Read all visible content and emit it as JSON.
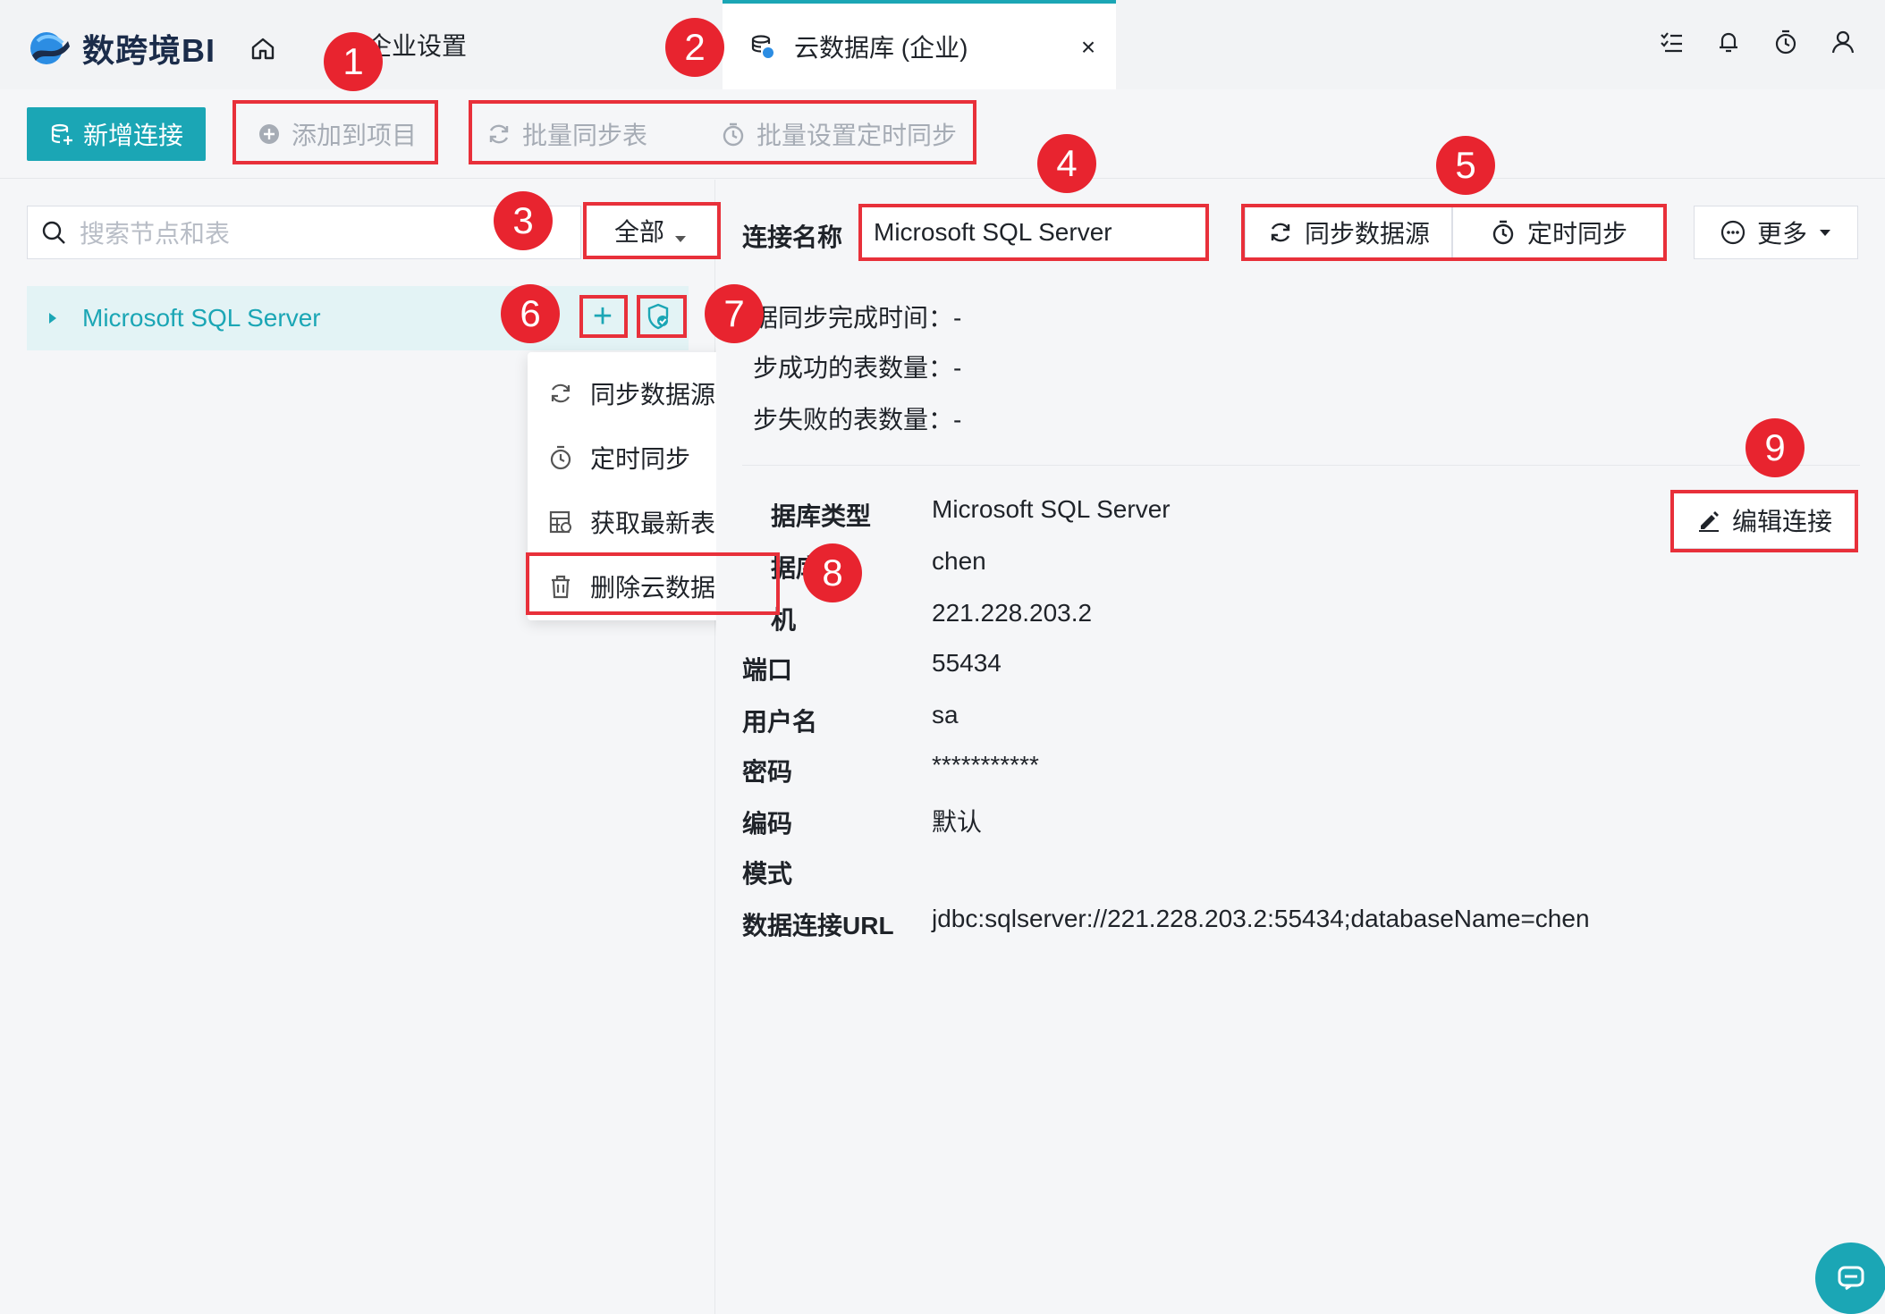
{
  "app": {
    "logo_text": "数跨境BI"
  },
  "tabs": [
    {
      "label": "企业设置"
    },
    {
      "label": "云数据库 (企业)",
      "close": "×"
    }
  ],
  "toolbar": {
    "new_connection": "新增连接",
    "add_to_project": "添加到项目",
    "batch_sync": "批量同步表",
    "batch_schedule": "批量设置定时同步"
  },
  "left": {
    "search_placeholder": "搜索节点和表",
    "filter": "全部",
    "tree_item": "Microsoft SQL Server",
    "tree_add": "+",
    "menu": [
      "同步数据源",
      "定时同步",
      "获取最新表",
      "删除云数据库"
    ]
  },
  "right": {
    "conn_name_label": "连接名称",
    "conn_name_value": "Microsoft SQL Server",
    "sync_button": "同步数据源",
    "schedule_button": "定时同步",
    "more_button": "更多",
    "stats": [
      {
        "label": "数据同步完成时间：",
        "visible": "据同步完成时间：",
        "value": "-"
      },
      {
        "label": "同步成功的表数量：",
        "visible": "步成功的表数量：",
        "value": "-"
      },
      {
        "label": "同步失败的表数量：",
        "visible": "步失败的表数量：",
        "value": "-"
      }
    ],
    "edit_button": "编辑连接",
    "info": [
      {
        "label": "据库类型",
        "value": "Microsoft SQL Server"
      },
      {
        "label": "据库",
        "value": "chen"
      },
      {
        "label": "机",
        "value": "221.228.203.2"
      },
      {
        "label": "端口",
        "value": "55434"
      },
      {
        "label": "用户名",
        "value": "sa"
      },
      {
        "label": "密码",
        "value": "***********"
      },
      {
        "label": "编码",
        "value": "默认"
      },
      {
        "label": "模式",
        "value": ""
      },
      {
        "label": "数据连接URL",
        "value": "jdbc:sqlserver://221.228.203.2:55434;databaseName=chen"
      }
    ]
  },
  "annotations": [
    "1",
    "2",
    "3",
    "4",
    "5",
    "6",
    "7",
    "8",
    "9"
  ],
  "colors": {
    "accent": "#1ba6b5",
    "annotation_red": "#e8303a",
    "text": "#1f2329",
    "disabled": "#a6acb5"
  }
}
